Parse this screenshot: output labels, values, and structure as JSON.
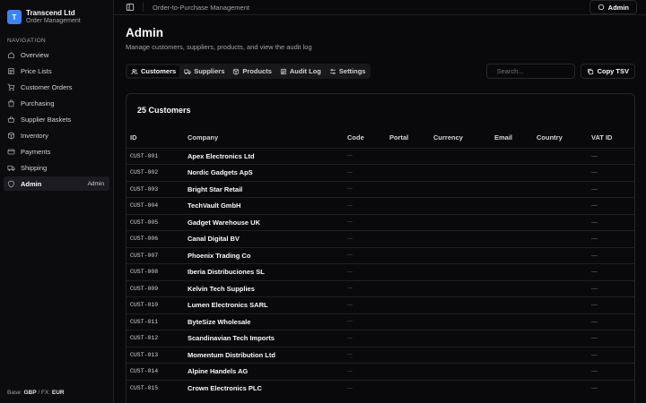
{
  "brand": {
    "initial": "T",
    "name": "Transcend Ltd",
    "subtitle": "Order Management",
    "accent": "#3b82f6"
  },
  "sidebar": {
    "heading": "NAVIGATION",
    "items": [
      {
        "label": "Overview",
        "icon": "home-icon"
      },
      {
        "label": "Price Lists",
        "icon": "list-icon"
      },
      {
        "label": "Customer Orders",
        "icon": "cart-icon"
      },
      {
        "label": "Purchasing",
        "icon": "shopping-bag-icon"
      },
      {
        "label": "Supplier Baskets",
        "icon": "basket-icon"
      },
      {
        "label": "Inventory",
        "icon": "package-icon"
      },
      {
        "label": "Payments",
        "icon": "credit-card-icon"
      },
      {
        "label": "Shipping",
        "icon": "truck-icon"
      },
      {
        "label": "Admin",
        "icon": "shield-icon",
        "active": true,
        "badge": "Admin"
      }
    ],
    "footer": {
      "base_label": "Base:",
      "base_value": "GBP",
      "fx_label": "/ FX:",
      "fx_value": "EUR"
    }
  },
  "topbar": {
    "title": "Order-to-Purchase Management",
    "user_button": "Admin"
  },
  "page": {
    "title": "Admin",
    "subtitle": "Manage customers, suppliers, products, and view the audit log"
  },
  "tabs": [
    {
      "label": "Customers",
      "icon": "users-icon",
      "active": true
    },
    {
      "label": "Suppliers",
      "icon": "truck-icon"
    },
    {
      "label": "Products",
      "icon": "package-icon"
    },
    {
      "label": "Audit Log",
      "icon": "list-icon"
    },
    {
      "label": "Settings",
      "icon": "sliders-icon"
    }
  ],
  "search": {
    "placeholder": "Search..."
  },
  "copy_button": "Copy TSV",
  "card": {
    "title": "25 Customers"
  },
  "table": {
    "columns": [
      "ID",
      "Company",
      "Code",
      "Portal",
      "Currency",
      "Email",
      "Country",
      "VAT ID"
    ],
    "empty_cell": "—",
    "rows": [
      {
        "id": "CUST-001",
        "company": "Apex Electronics Ltd"
      },
      {
        "id": "CUST-002",
        "company": "Nordic Gadgets ApS"
      },
      {
        "id": "CUST-003",
        "company": "Bright Star Retail"
      },
      {
        "id": "CUST-004",
        "company": "TechVault GmbH"
      },
      {
        "id": "CUST-005",
        "company": "Gadget Warehouse UK"
      },
      {
        "id": "CUST-006",
        "company": "Canal Digital BV"
      },
      {
        "id": "CUST-007",
        "company": "Phoenix Trading Co"
      },
      {
        "id": "CUST-008",
        "company": "Iberia Distribuciones SL"
      },
      {
        "id": "CUST-009",
        "company": "Kelvin Tech Supplies"
      },
      {
        "id": "CUST-010",
        "company": "Lumen Electronics SARL"
      },
      {
        "id": "CUST-011",
        "company": "ByteSize Wholesale"
      },
      {
        "id": "CUST-012",
        "company": "Scandinavian Tech Imports"
      },
      {
        "id": "CUST-013",
        "company": "Momentum Distribution Ltd"
      },
      {
        "id": "CUST-014",
        "company": "Alpine Handels AG"
      },
      {
        "id": "CUST-015",
        "company": "Crown Electronics PLC"
      }
    ]
  }
}
